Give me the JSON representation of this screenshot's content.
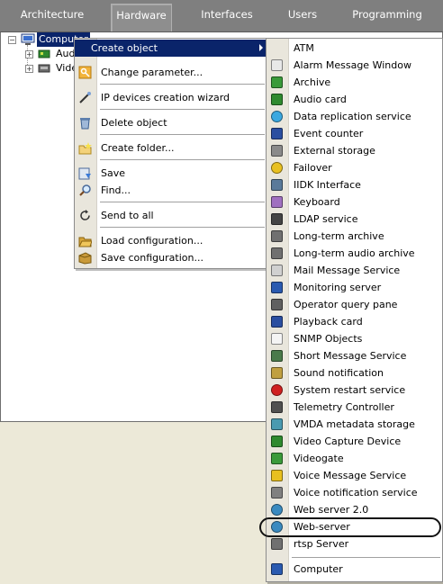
{
  "tabs": [
    {
      "label": "Architecture",
      "active": false
    },
    {
      "label": "Hardware",
      "active": true
    },
    {
      "label": "Interfaces",
      "active": false
    },
    {
      "label": "Users",
      "active": false
    },
    {
      "label": "Programming",
      "active": false
    }
  ],
  "tree": {
    "root": "Computer",
    "children": [
      "Aud",
      "Vide"
    ]
  },
  "context_menu": {
    "items": [
      {
        "label": "Create object",
        "icon": "none",
        "highlighted": true,
        "has_submenu": true
      },
      {
        "label": "Change parameter...",
        "icon": "key-icon"
      },
      {
        "label": "IP devices creation wizard",
        "icon": "wand-icon"
      },
      {
        "label": "Delete object",
        "icon": "recycle-bin-icon"
      },
      {
        "label": "Create folder...",
        "icon": "new-folder-icon"
      },
      {
        "label": "Save",
        "icon": "save-icon"
      },
      {
        "label": "Find...",
        "icon": "magnifier-icon"
      },
      {
        "label": "Send to all",
        "icon": "refresh-icon"
      },
      {
        "label": "Load configuration...",
        "icon": "folder-open-icon"
      },
      {
        "label": "Save configuration...",
        "icon": "box-icon"
      }
    ]
  },
  "submenu": {
    "items": [
      {
        "label": "ATM",
        "icon": "none"
      },
      {
        "label": "Alarm Message Window",
        "icon": "window-list-icon"
      },
      {
        "label": "Archive",
        "icon": "archive-icon"
      },
      {
        "label": "Audio card",
        "icon": "audio-card-icon"
      },
      {
        "label": "Data replication service",
        "icon": "replication-icon"
      },
      {
        "label": "Event counter",
        "icon": "counter-icon"
      },
      {
        "label": "External storage",
        "icon": "storage-icon"
      },
      {
        "label": "Failover",
        "icon": "failover-icon"
      },
      {
        "label": "IIDK Interface",
        "icon": "interface-icon"
      },
      {
        "label": "Keyboard",
        "icon": "keyboard-icon"
      },
      {
        "label": "LDAP service",
        "icon": "ldap-icon"
      },
      {
        "label": "Long-term archive",
        "icon": "tape-icon"
      },
      {
        "label": "Long-term audio archive",
        "icon": "tape-icon"
      },
      {
        "label": "Mail Message Service",
        "icon": "mail-icon"
      },
      {
        "label": "Monitoring server",
        "icon": "monitor-server-icon"
      },
      {
        "label": "Operator query pane",
        "icon": "query-icon"
      },
      {
        "label": "Playback card",
        "icon": "playback-icon"
      },
      {
        "label": "SNMP Objects",
        "icon": "snmp-icon"
      },
      {
        "label": "Short Message Service",
        "icon": "phone-icon"
      },
      {
        "label": "Sound notification",
        "icon": "sound-icon"
      },
      {
        "label": "System restart service",
        "icon": "power-icon"
      },
      {
        "label": "Telemetry Controller",
        "icon": "telemetry-icon"
      },
      {
        "label": "VMDA metadata storage",
        "icon": "database-icon"
      },
      {
        "label": "Video Capture Device",
        "icon": "capture-card-icon"
      },
      {
        "label": "Videogate",
        "icon": "videogate-icon"
      },
      {
        "label": "Voice Message Service",
        "icon": "voice-message-icon"
      },
      {
        "label": "Voice notification service",
        "icon": "speaker-icon"
      },
      {
        "label": "Web server 2.0",
        "icon": "globe-icon"
      },
      {
        "label": "Web-server",
        "icon": "globe-icon",
        "circled": true
      },
      {
        "label": "rtsp Server",
        "icon": "screen-icon"
      },
      {
        "label": "Computer",
        "icon": "computer-icon"
      }
    ]
  },
  "colors": {
    "tab_bar": "#7f7f7f",
    "highlight": "#0a246a",
    "menu_gutter": "#e9e6dc",
    "background_below": "#ece9d8"
  }
}
